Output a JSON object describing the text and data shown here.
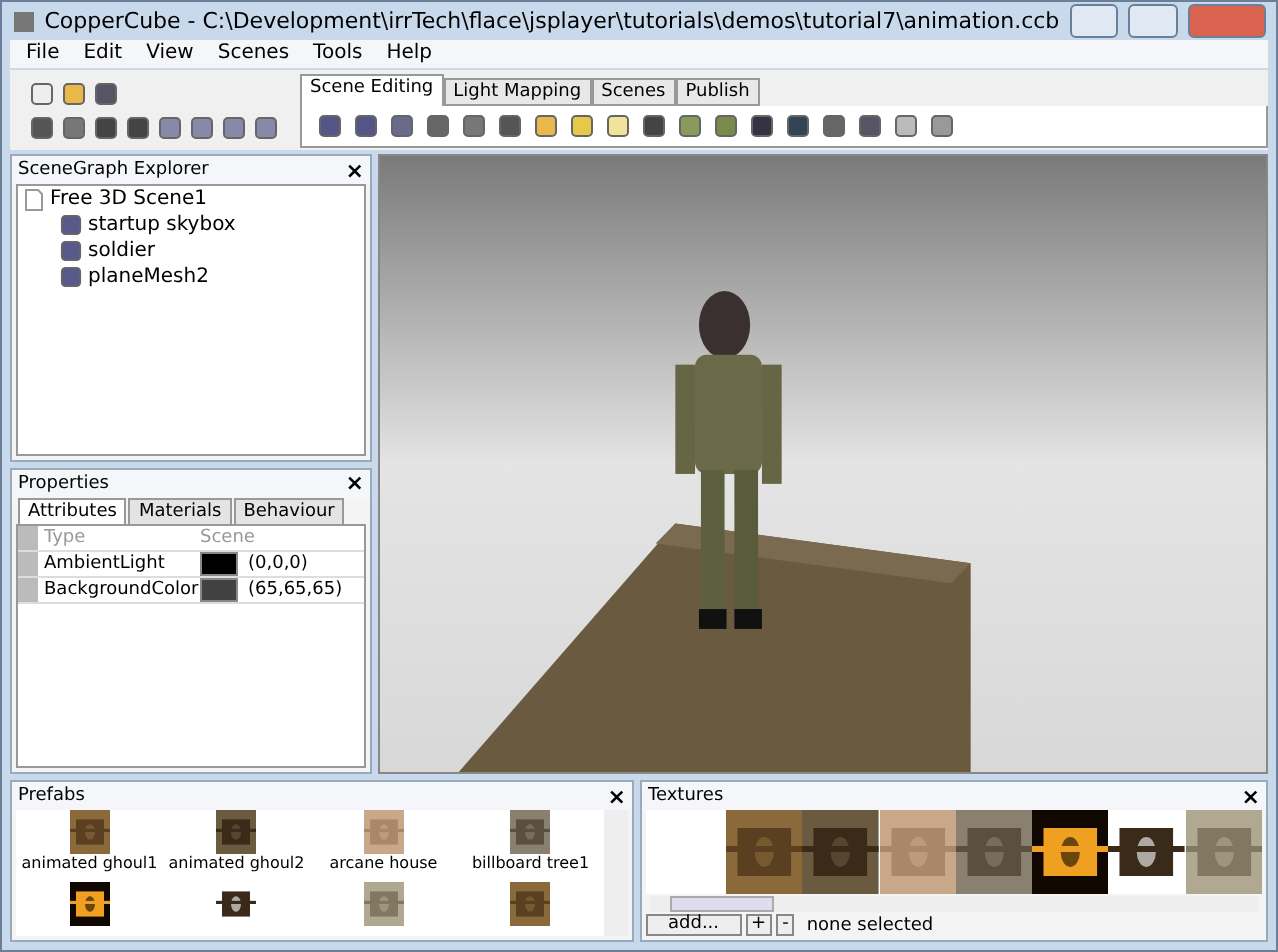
{
  "window": {
    "title": "CopperCube - C:\\Development\\irrTech\\flace\\jsplayer\\tutorials\\demos\\tutorial7\\animation.ccb"
  },
  "menu": [
    {
      "label": "File"
    },
    {
      "label": "Edit"
    },
    {
      "label": "View"
    },
    {
      "label": "Scenes"
    },
    {
      "label": "Tools"
    },
    {
      "label": "Help"
    }
  ],
  "editor_tabs": [
    {
      "label": "Scene Editing",
      "selected": true
    },
    {
      "label": "Light Mapping",
      "selected": false
    },
    {
      "label": "Scenes",
      "selected": false
    },
    {
      "label": "Publish",
      "selected": false
    }
  ],
  "scene_graph": {
    "title": "SceneGraph Explorer",
    "close": "×",
    "tree": [
      {
        "label": "Free 3D Scene1",
        "children": [
          {
            "label": "startup skybox"
          },
          {
            "label": "soldier"
          },
          {
            "label": "planeMesh2"
          }
        ]
      }
    ]
  },
  "properties": {
    "title": "Properties",
    "close": "×",
    "tabs": [
      {
        "label": "Attributes",
        "selected": true
      },
      {
        "label": "Materials",
        "selected": false
      },
      {
        "label": "Behaviour",
        "selected": false
      }
    ],
    "header": [
      "Type",
      "Scene"
    ],
    "rows": [
      {
        "name": "AmbientLight",
        "color": "#000000",
        "value": "(0,0,0)"
      },
      {
        "name": "BackgroundColor",
        "color": "#414141",
        "value": "(65,65,65)"
      }
    ]
  },
  "prefabs": {
    "title": "Prefabs",
    "close": "×",
    "items": [
      {
        "kind": "labeled",
        "label": "animated ghoul1"
      },
      {
        "kind": "labeled",
        "label": "animated ghoul2"
      },
      {
        "kind": "labeled",
        "label": "arcane house"
      },
      {
        "kind": "labeled",
        "label": "billboard tree1"
      },
      {
        "kind": "picture"
      },
      {
        "kind": "picture"
      },
      {
        "kind": "picture"
      },
      {
        "kind": "picture"
      }
    ]
  },
  "textures": {
    "title": "Textures",
    "close": "×",
    "add_button": "add...",
    "plus_button": "+",
    "minus_button": "-",
    "status": "none selected"
  }
}
